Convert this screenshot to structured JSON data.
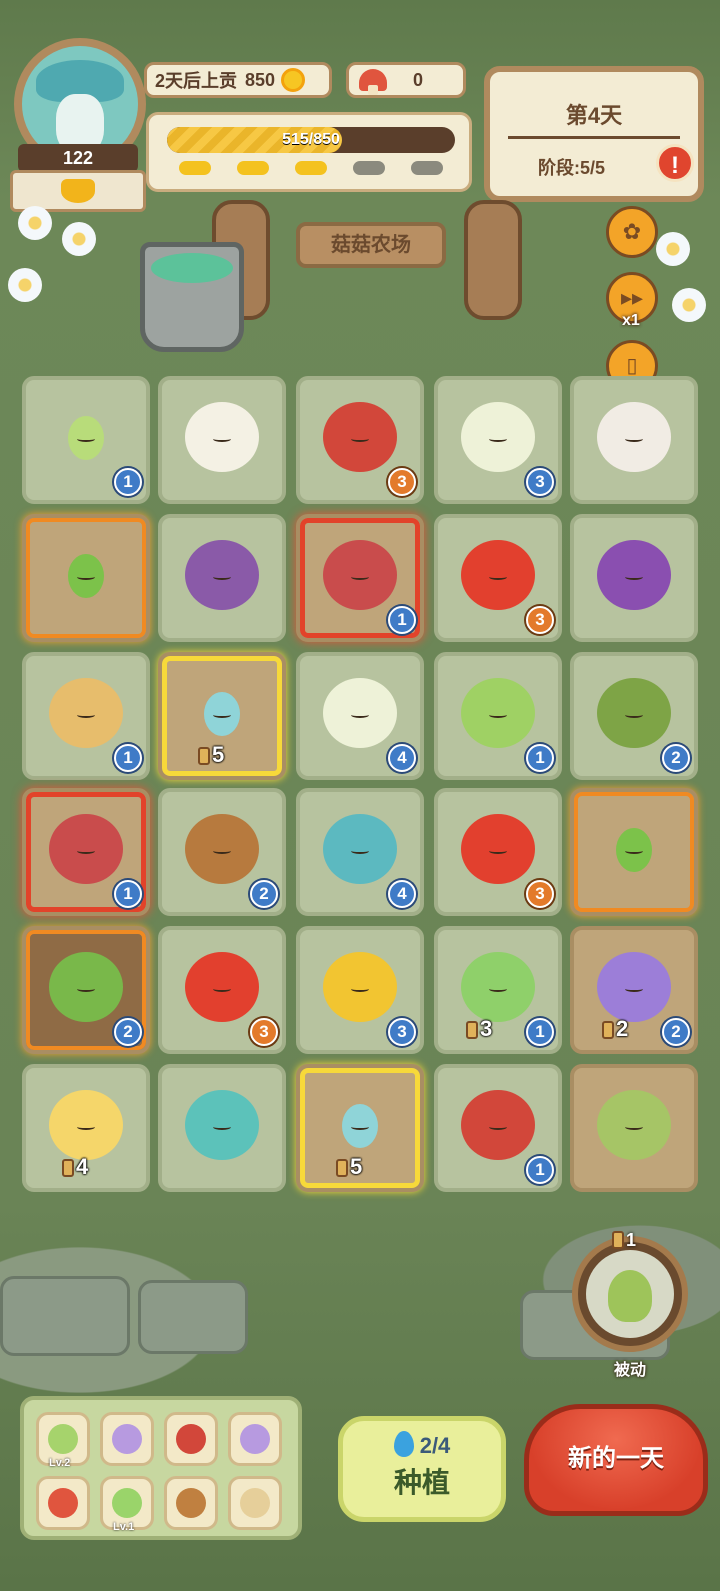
{
  "header": {
    "level": "122",
    "deadline_label": "2天后上贡",
    "deadline_amount": "850",
    "mushroom_count": "0",
    "progress_text": "515/850",
    "progress_fraction": 0.606,
    "stage_pips_filled": 3,
    "stage_pips_total": 5
  },
  "day_panel": {
    "title": "第4天",
    "stage": "阶段:5/5",
    "alert": "!"
  },
  "side_buttons": {
    "settings_icon": "gear-icon",
    "speed_label": "x1",
    "help_label": "帮助"
  },
  "farm_sign": "菇菇农场",
  "tiles": [
    {
      "name": "lettuce-sprout",
      "badge": "1",
      "badge_color": "blue"
    },
    {
      "name": "radish",
      "badge": "",
      "badge_color": ""
    },
    {
      "name": "ladybug",
      "badge": "3",
      "badge_color": "orange"
    },
    {
      "name": "bok-choy",
      "badge": "3",
      "badge_color": "blue"
    },
    {
      "name": "sheep",
      "badge": "",
      "badge_color": ""
    },
    {
      "name": "pepper-sprout",
      "badge": "",
      "badge_color": ""
    },
    {
      "name": "beetle",
      "badge": "",
      "badge_color": ""
    },
    {
      "name": "red-mushroom",
      "badge": "1",
      "badge_color": "blue"
    },
    {
      "name": "red-pepper",
      "badge": "3",
      "badge_color": "orange"
    },
    {
      "name": "eggplant",
      "badge": "",
      "badge_color": ""
    },
    {
      "name": "potato",
      "badge": "1",
      "badge_color": "blue"
    },
    {
      "name": "blue-mushroom-sprout",
      "timer": "5"
    },
    {
      "name": "bok-choy-large",
      "badge": "4",
      "badge_color": "blue"
    },
    {
      "name": "lettuce",
      "badge": "1",
      "badge_color": "blue"
    },
    {
      "name": "avocado",
      "badge": "2",
      "badge_color": "blue"
    },
    {
      "name": "red-mushroom-small",
      "badge": "1",
      "badge_color": "blue"
    },
    {
      "name": "brown-mushroom",
      "badge": "2",
      "badge_color": "blue"
    },
    {
      "name": "blue-mushroom",
      "badge": "4",
      "badge_color": "blue"
    },
    {
      "name": "red-pepper",
      "badge": "3",
      "badge_color": "orange"
    },
    {
      "name": "pepper-sprout",
      "badge": "",
      "badge_color": ""
    },
    {
      "name": "green-pepper",
      "badge": "2",
      "badge_color": "blue"
    },
    {
      "name": "red-pepper",
      "badge": "3",
      "badge_color": "orange"
    },
    {
      "name": "bee",
      "badge": "3",
      "badge_color": "blue"
    },
    {
      "name": "caterpillar",
      "badge": "1",
      "badge_color": "blue",
      "timer": "3"
    },
    {
      "name": "butterfly",
      "badge": "2",
      "badge_color": "blue",
      "timer": "2"
    },
    {
      "name": "yellow-pepper",
      "timer": "4"
    },
    {
      "name": "snail",
      "badge": "",
      "badge_color": ""
    },
    {
      "name": "blue-mushroom-sprout",
      "timer": "5"
    },
    {
      "name": "ladybug-small",
      "badge": "1",
      "badge_color": "blue"
    },
    {
      "name": "cocoon",
      "badge": "",
      "badge_color": ""
    }
  ],
  "passive": {
    "label": "被动",
    "count": "1"
  },
  "inventory": [
    {
      "name": "lettuce-item",
      "lv": "Lv.2"
    },
    {
      "name": "seed-packet",
      "lv": ""
    },
    {
      "name": "ladybug-item",
      "lv": ""
    },
    {
      "name": "seed-packet",
      "lv": ""
    },
    {
      "name": "mushroom-item",
      "lv": ""
    },
    {
      "name": "sprout-item",
      "lv": "Lv.1"
    },
    {
      "name": "brown-mushroom-item",
      "lv": ""
    },
    {
      "name": "scroll-item",
      "lv": ""
    }
  ],
  "plant_button": {
    "water": "2/4",
    "label": "种植"
  },
  "new_day_button": "新的一天",
  "colors": {
    "badge_blue": "#3f7bc7",
    "badge_orange": "#e37a2b",
    "highlight_orange": "#f08a22",
    "highlight_red": "#e2432a",
    "highlight_yellow": "#f7d93a"
  }
}
